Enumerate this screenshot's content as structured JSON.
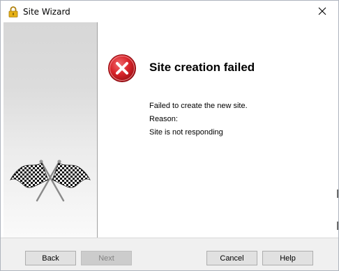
{
  "window": {
    "title": "Site Wizard",
    "title_icon": "lock-icon",
    "close_icon": "close-icon"
  },
  "banner": {
    "image": "checkered-flags-icon"
  },
  "result": {
    "status_icon": "error-icon",
    "heading": "Site creation failed",
    "message_line1": "Failed to create the new site.",
    "reason_label": "Reason:",
    "reason_text": "Site is not responding"
  },
  "buttons": {
    "back": "Back",
    "next": "Next",
    "next_enabled": false,
    "cancel": "Cancel",
    "help": "Help"
  },
  "colors": {
    "error_red": "#d9252b",
    "lock_gold": "#e6b116"
  }
}
